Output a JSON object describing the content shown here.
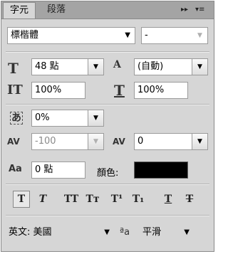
{
  "tabs": {
    "active": "字元",
    "inactive": "段落"
  },
  "tab_controls": {
    "collapse": "▸▸",
    "menu": "▾≡"
  },
  "font": {
    "family": "標楷體",
    "style": "-"
  },
  "size": {
    "font_size": "48 點",
    "leading": "(自動)"
  },
  "scale": {
    "vertical": "100%",
    "horizontal": "100%"
  },
  "spacing": {
    "proportional": "0%",
    "kerning": "-100",
    "tracking": "0"
  },
  "baseline": {
    "shift": "0 點"
  },
  "color": {
    "label": "顏色:",
    "swatch": "#000000"
  },
  "icons": {
    "font_size": "T",
    "leading": "A",
    "vertical_scale": "IT",
    "horizontal_scale": "T",
    "proportional": "あ",
    "kerning": "AV",
    "tracking": "AV",
    "baseline": "Aa"
  },
  "style_buttons": [
    {
      "name": "faux-bold-button",
      "label": "T",
      "pressed": true
    },
    {
      "name": "faux-italic-button",
      "label": "T"
    },
    {
      "name": "all-caps-button",
      "label": "TT"
    },
    {
      "name": "small-caps-button",
      "label": "Tт"
    },
    {
      "name": "superscript-button",
      "label": "T¹"
    },
    {
      "name": "subscript-button",
      "label": "T₁"
    },
    {
      "name": "underline-button",
      "label": "T"
    },
    {
      "name": "strikethrough-button",
      "label": "T"
    }
  ],
  "language": {
    "value": "英文: 美國"
  },
  "antialias": {
    "icon": "ªa",
    "value": "平滑"
  },
  "arrow_glyph": "▼"
}
